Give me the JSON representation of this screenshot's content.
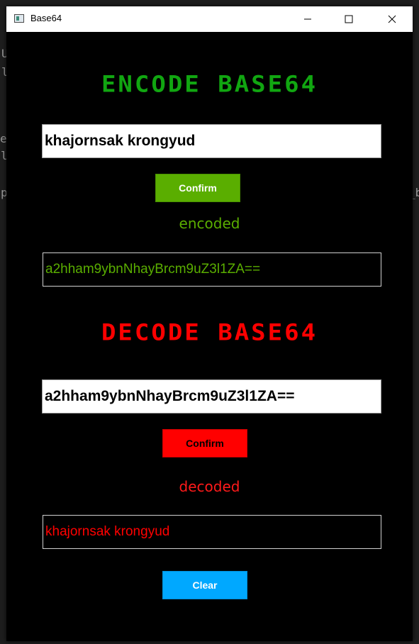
{
  "window": {
    "title": "Base64",
    "icon": "app-window-icon",
    "controls": [
      "minimize-icon",
      "maximize-icon",
      "close-icon"
    ]
  },
  "background_fragments": [
    "U",
    "l",
    "e",
    "l",
    "p",
    "_b"
  ],
  "encode": {
    "heading": "ENCODE BASE64",
    "input_value": "khajornsak krongyud",
    "confirm_label": "Confirm",
    "status": "encoded",
    "output": "a2hham9ybnNhayBrcm9uZ3l1ZA=="
  },
  "decode": {
    "heading": "DECODE BASE64",
    "input_value": "a2hham9ybnNhayBrcm9uZ3l1ZA==",
    "confirm_label": "Confirm",
    "status": "decoded",
    "output": "khajornsak krongyud"
  },
  "clear_label": "Clear",
  "colors": {
    "encode_accent": "#11a611",
    "encode_button": "#5aae00",
    "decode_accent": "#ff0000",
    "clear_button": "#00a8ff",
    "background": "#000000"
  }
}
